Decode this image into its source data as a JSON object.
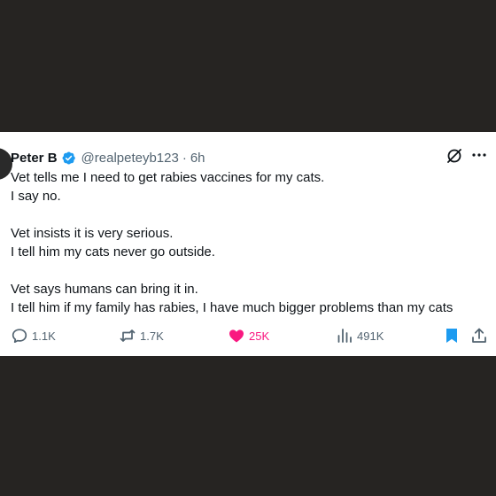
{
  "tweet": {
    "author_name": "Peter B",
    "handle": "@realpeteyb123",
    "separator": "·",
    "time": "6h",
    "lines": [
      "Vet tells me I need to get rabies vaccines for my cats.",
      "I say no.",
      "Vet insists it is very serious.",
      "I tell him my cats never go outside.",
      "Vet says humans can bring it in.",
      "I tell him if my family has rabies, I have much bigger problems than my cats"
    ]
  },
  "actions": {
    "replies": "1.1K",
    "reposts": "1.7K",
    "likes": "25K",
    "views": "491K"
  },
  "colors": {
    "verified": "#1d9bf0",
    "like": "#f91880",
    "bookmark": "#1d9bf0",
    "muted_text": "#536471",
    "background": "#262422"
  },
  "icons": [
    "verified-badge-icon",
    "grok-icon",
    "more-icon",
    "reply-icon",
    "repost-icon",
    "like-icon",
    "views-icon",
    "bookmark-icon",
    "share-icon"
  ]
}
